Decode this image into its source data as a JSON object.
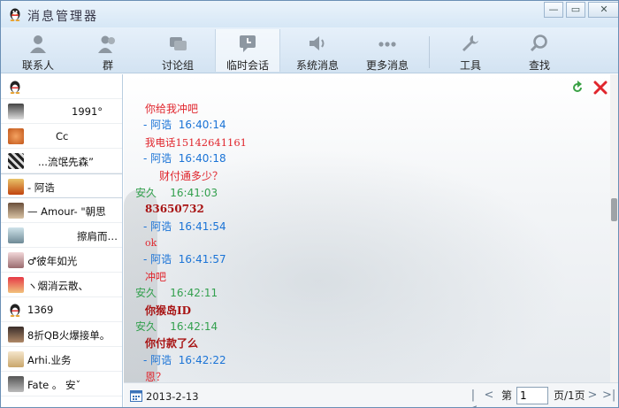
{
  "window": {
    "title": "消息管理器"
  },
  "toolbar": {
    "items": [
      {
        "label": "联系人",
        "icon": "contacts-icon"
      },
      {
        "label": "群",
        "icon": "group-icon"
      },
      {
        "label": "讨论组",
        "icon": "discussion-icon"
      },
      {
        "label": "临时会话",
        "icon": "temp-chat-icon",
        "active": true
      },
      {
        "label": "系统消息",
        "icon": "speaker-icon"
      },
      {
        "label": "更多消息",
        "icon": "more-icon"
      },
      {
        "label": "工具",
        "icon": "wrench-icon"
      },
      {
        "label": "查找",
        "icon": "search-icon"
      }
    ]
  },
  "contacts": [
    {
      "name": "",
      "avatar": "qq-penguin-icon"
    },
    {
      "name": "1991°",
      "avatar": "avatar"
    },
    {
      "name": "Cc",
      "avatar": "avatar"
    },
    {
      "name": "...流氓先森”",
      "avatar": "avatar"
    },
    {
      "name": "- 阿诰",
      "avatar": "avatar",
      "selected": true
    },
    {
      "name": "— Amour- \"朝思",
      "avatar": "avatar"
    },
    {
      "name": "擦肩而…",
      "avatar": "avatar"
    },
    {
      "name": "♂彼年如光",
      "avatar": "avatar"
    },
    {
      "name": "ヽ烟消云散、",
      "avatar": "avatar"
    },
    {
      "name": "1369",
      "avatar": "qq-penguin-icon"
    },
    {
      "name": "8折QB火爆接单。",
      "avatar": "avatar"
    },
    {
      "name": "Arhi.业务",
      "avatar": "avatar"
    },
    {
      "name": "Fate 。  安ˇ",
      "avatar": "avatar"
    }
  ],
  "messages": [
    {
      "text": "你给我冲吧",
      "style": "red"
    },
    {
      "sender": "- 阿诰",
      "time": "16:40:14",
      "side": "blue"
    },
    {
      "text": "我电话15142641161",
      "style": "red"
    },
    {
      "sender": "- 阿诰",
      "time": "16:40:18",
      "side": "blue"
    },
    {
      "text": "财付通多少？",
      "style": "red"
    },
    {
      "sender": "安久",
      "time": "16:41:03",
      "side": "green"
    },
    {
      "text": "83650732",
      "style": "darkred-bold"
    },
    {
      "sender": "- 阿诰",
      "time": "16:41:54",
      "side": "blue"
    },
    {
      "text": "ok",
      "style": "red-serif"
    },
    {
      "sender": "- 阿诰",
      "time": "16:41:57",
      "side": "blue"
    },
    {
      "text": "冲吧",
      "style": "red"
    },
    {
      "sender": "安久",
      "time": "16:42:11",
      "side": "green"
    },
    {
      "text": "你猴岛ID",
      "style": "darkred-bold"
    },
    {
      "sender": "安久",
      "time": "16:42:14",
      "side": "green"
    },
    {
      "text": "你付款了么",
      "style": "darkred-bold"
    },
    {
      "sender": "- 阿诰",
      "time": "16:42:22",
      "side": "blue"
    },
    {
      "text": "恩？",
      "style": "red"
    }
  ],
  "bottom": {
    "date": "2013-2-13",
    "page_prefix": "第",
    "page_value": "1",
    "page_suffix": "页/1页"
  }
}
